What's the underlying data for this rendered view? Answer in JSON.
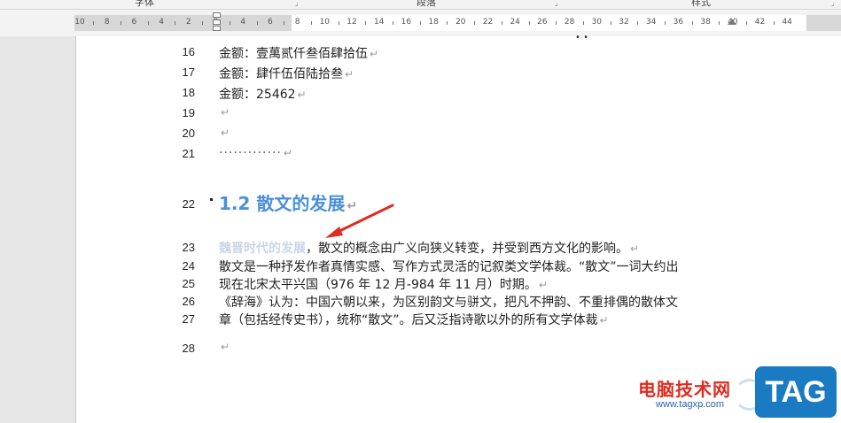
{
  "ribbon": {
    "groups": [
      {
        "label": "字体"
      },
      {
        "label": "段落"
      },
      {
        "label": "样式"
      }
    ]
  },
  "ruler": {
    "labels": [
      "10",
      "8",
      "6",
      "4",
      "2",
      "2",
      "4",
      "6",
      "8",
      "10",
      "12",
      "14",
      "16",
      "18",
      "20",
      "22",
      "24",
      "26",
      "28",
      "30",
      "32",
      "34",
      "36",
      "38",
      "40",
      "42",
      "44"
    ]
  },
  "document": {
    "lines": [
      {
        "num": "16",
        "text": "金额：壹萬贰仟叁佰肆拾伍",
        "mark": "↵"
      },
      {
        "num": "17",
        "text": "金额：肆仟伍佰陆拾叁",
        "mark": "↵"
      },
      {
        "num": "18",
        "text": "金额：25462",
        "mark": "↵"
      },
      {
        "num": "19",
        "text": "",
        "mark": "↵"
      },
      {
        "num": "20",
        "text": "",
        "mark": "↵"
      },
      {
        "num": "21",
        "text": "·············",
        "mark": "↵"
      }
    ],
    "heading": {
      "num": "22",
      "text": "1.2 散文的发展",
      "mark": "↵"
    },
    "body": [
      {
        "num": "23",
        "faded": "魏晋时代的发展",
        "text": "，散文的概念由广义向狭义转变，并受到西方文化的影响。",
        "mark": "↵"
      },
      {
        "num": "24",
        "text": "散文是一种抒发作者真情实感、写作方式灵活的记叙类文学体裁。“散文”一词大约出",
        "mark": ""
      },
      {
        "num": "25",
        "text": "现在北宋太平兴国（976 年 12 月-984 年 11 月）时期。",
        "mark": "↵"
      },
      {
        "num": "26",
        "text": "《辞海》认为：中国六朝以来，为区别韵文与骈文，把凡不押韵、不重排偶的散体文",
        "mark": ""
      },
      {
        "num": "27",
        "text": "章（包括经传史书），统称“散文”。后又泛指诗歌以外的所有文学体裁",
        "mark": "↵"
      },
      {
        "num": "28",
        "text": "",
        "mark": "↵"
      }
    ]
  },
  "watermark": {
    "site_name": "电脑技术网",
    "url": "www.tagxp.com",
    "badge": "TAG"
  },
  "colors": {
    "heading": "#4a90d9",
    "arrow": "#e02b20",
    "watermark_red": "#e02b20",
    "watermark_blue": "#1a7ac2"
  }
}
